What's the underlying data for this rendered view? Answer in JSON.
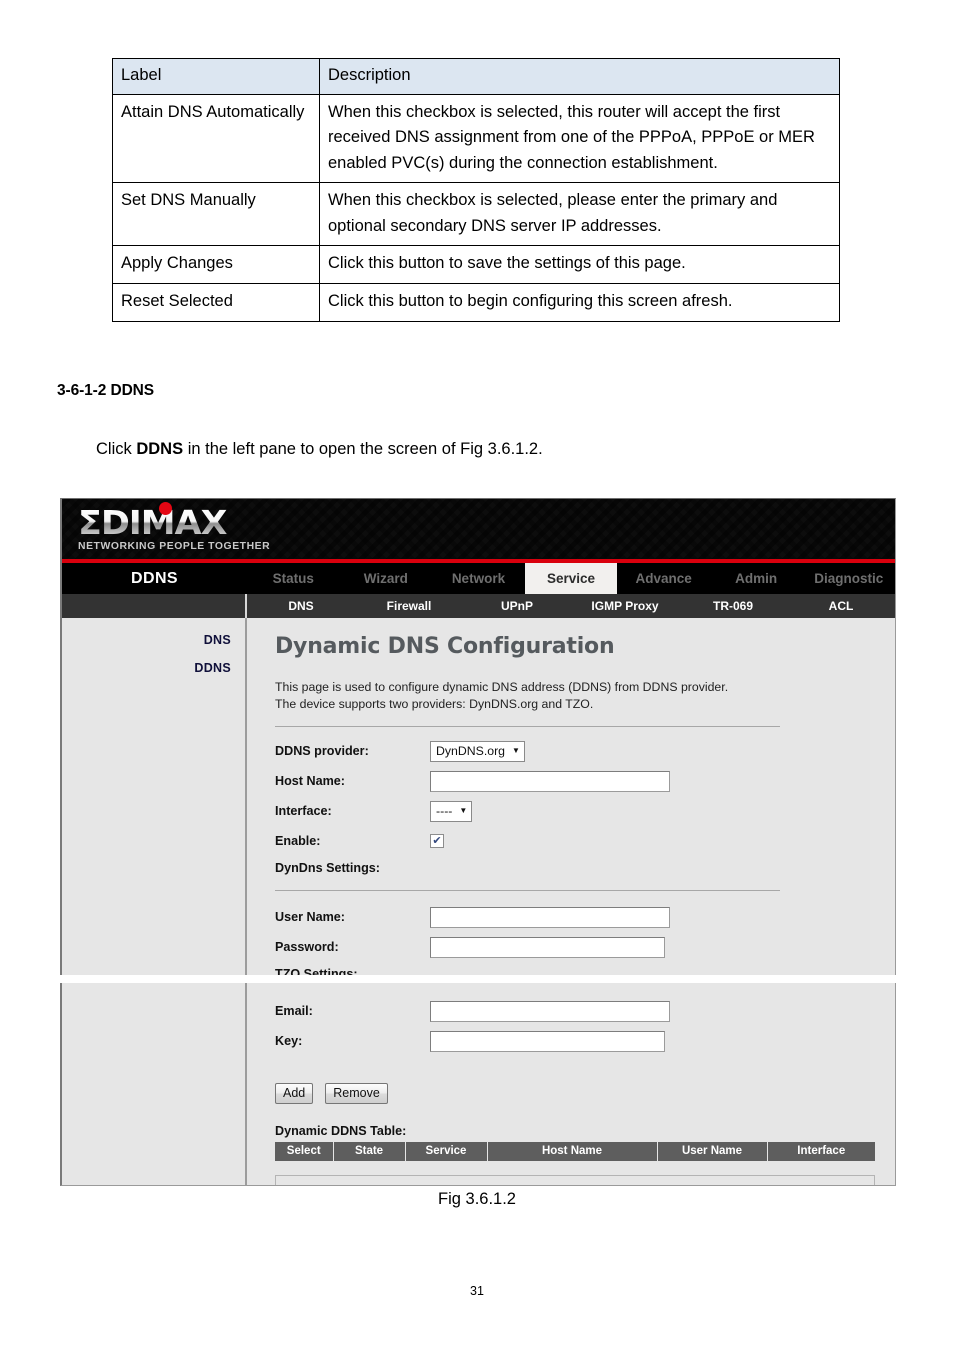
{
  "doc": {
    "table": {
      "headers": [
        "Label",
        "Description"
      ],
      "rows": [
        {
          "label": "Attain DNS Automatically",
          "description": "When this checkbox is selected, this router will accept the first received DNS assignment from one of the PPPoA, PPPoE or MER enabled PVC(s) during the connection establishment."
        },
        {
          "label": "Set DNS Manually",
          "description": "When this checkbox is selected, please enter the primary and optional secondary DNS server IP addresses."
        },
        {
          "label": "Apply Changes",
          "description": "Click this button to save the settings of this page."
        },
        {
          "label": "Reset Selected",
          "description": "Click this button to begin configuring this screen afresh."
        }
      ]
    },
    "section_heading": "3-6-1-2 DDNS",
    "paragraph_pre": "Click ",
    "paragraph_bold": "DDNS",
    "paragraph_post": " in the left pane to open the screen of Fig 3.6.1.2.",
    "figure_caption": "Fig 3.6.1.2",
    "page_number": "31"
  },
  "router": {
    "logo": {
      "mark": "ΣDIMAX",
      "tagline": "NETWORKING PEOPLE TOGETHER",
      "dot": "red-dot-icon",
      "accent_color": "#d9000d"
    },
    "brand_label": "DDNS",
    "nav": [
      {
        "label": "Status",
        "active": false
      },
      {
        "label": "Wizard",
        "active": false
      },
      {
        "label": "Network",
        "active": false
      },
      {
        "label": "Service",
        "active": true
      },
      {
        "label": "Advance",
        "active": false
      },
      {
        "label": "Admin",
        "active": false
      },
      {
        "label": "Diagnostic",
        "active": false
      }
    ],
    "subnav": [
      "DNS",
      "Firewall",
      "UPnP",
      "IGMP Proxy",
      "TR-069",
      "ACL"
    ],
    "sidebar": [
      "DNS",
      "DDNS"
    ],
    "page_title": "Dynamic DNS Configuration",
    "page_desc_line1": "This page is used to configure dynamic DNS address (DDNS) from DDNS provider.",
    "page_desc_line2": "The device supports two providers: DynDNS.org and TZO.",
    "form": {
      "provider_label": "DDNS provider:",
      "provider_value": "DynDNS.org",
      "hostname_label": "Host Name:",
      "hostname_value": "",
      "interface_label": "Interface:",
      "interface_value": "----",
      "enable_label": "Enable:",
      "enable_checked": "✔",
      "dyndns_group": "DynDns Settings:",
      "username_label": "User Name:",
      "username_value": "",
      "password_label": "Password:",
      "password_value": "",
      "tzo_group": "TZO Settings:",
      "email_label": "Email:",
      "email_value": "",
      "key_label": "Key:",
      "key_value": ""
    },
    "buttons": {
      "add": "Add",
      "remove": "Remove"
    },
    "table": {
      "caption": "Dynamic DDNS Table:",
      "headers": [
        "Select",
        "State",
        "Service",
        "Host Name",
        "User Name",
        "Interface"
      ],
      "rows": []
    }
  }
}
